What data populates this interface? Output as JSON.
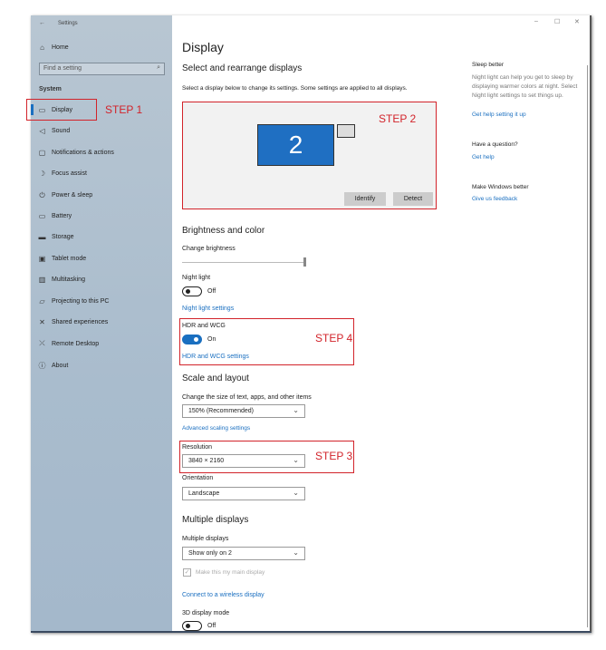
{
  "window": {
    "title": "Settings",
    "back": "←",
    "minimize": "–",
    "maximize": "☐",
    "close": "✕"
  },
  "sidebar": {
    "home": "Home",
    "search_placeholder": "Find a setting",
    "section": "System",
    "items": [
      {
        "label": "Display",
        "icon": "monitor-icon"
      },
      {
        "label": "Sound",
        "icon": "speaker-icon"
      },
      {
        "label": "Notifications & actions",
        "icon": "notification-icon"
      },
      {
        "label": "Focus assist",
        "icon": "moon-icon"
      },
      {
        "label": "Power & sleep",
        "icon": "power-icon"
      },
      {
        "label": "Battery",
        "icon": "battery-icon"
      },
      {
        "label": "Storage",
        "icon": "storage-icon"
      },
      {
        "label": "Tablet mode",
        "icon": "tablet-icon"
      },
      {
        "label": "Multitasking",
        "icon": "multitask-icon"
      },
      {
        "label": "Projecting to this PC",
        "icon": "project-icon"
      },
      {
        "label": "Shared experiences",
        "icon": "shared-icon"
      },
      {
        "label": "Remote Desktop",
        "icon": "remote-icon"
      },
      {
        "label": "About",
        "icon": "info-icon"
      }
    ]
  },
  "main": {
    "title": "Display",
    "select_heading": "Select and rearrange displays",
    "select_desc": "Select a display below to change its settings. Some settings are applied to all displays.",
    "monitor_number": "2",
    "identify": "Identify",
    "detect": "Detect",
    "brightness_heading": "Brightness and color",
    "change_brightness": "Change brightness",
    "brightness_value": 100,
    "night_light": "Night light",
    "night_light_state": "Off",
    "night_light_settings": "Night light settings",
    "hdr": "HDR and WCG",
    "hdr_state": "On",
    "hdr_settings": "HDR and WCG settings",
    "scale_heading": "Scale and layout",
    "scale_label": "Change the size of text, apps, and other items",
    "scale_value": "150% (Recommended)",
    "advanced_scaling": "Advanced scaling settings",
    "resolution_label": "Resolution",
    "resolution_value": "3840 × 2160",
    "orientation_label": "Orientation",
    "orientation_value": "Landscape",
    "multi_heading": "Multiple displays",
    "multi_label": "Multiple displays",
    "multi_value": "Show only on 2",
    "main_display": "Make this my main display",
    "wireless": "Connect to a wireless display",
    "mode3d": "3D display mode",
    "mode3d_state": "Off"
  },
  "right": {
    "sleep_heading": "Sleep better",
    "sleep_text": "Night light can help you get to sleep by displaying warmer colors at night. Select Night light settings to set things up.",
    "sleep_link": "Get help setting it up",
    "question": "Have a question?",
    "help_link": "Get help",
    "better": "Make Windows better",
    "feedback": "Give us feedback"
  },
  "steps": {
    "s1": "STEP 1",
    "s2": "STEP 2",
    "s3": "STEP 3",
    "s4": "STEP 4"
  },
  "colors": {
    "accent": "#1a6fc0",
    "step": "#d2232a",
    "monitor": "#1f6fc2"
  }
}
